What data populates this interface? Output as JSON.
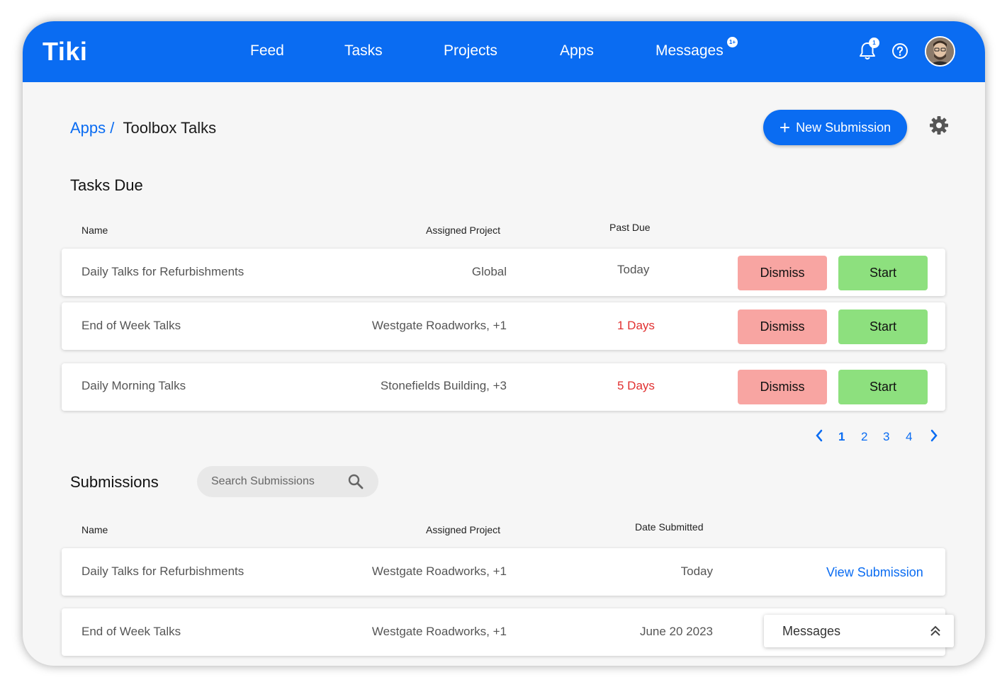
{
  "header": {
    "logo": "Tiki",
    "nav": [
      {
        "label": "Feed"
      },
      {
        "label": "Tasks"
      },
      {
        "label": "Projects"
      },
      {
        "label": "Apps"
      },
      {
        "label": "Messages",
        "badge": "1+"
      }
    ],
    "notification_badge": "1",
    "icons": [
      "bell-icon",
      "help-icon",
      "avatar"
    ]
  },
  "breadcrumb": {
    "parent": "Apps /",
    "current": "Toolbox Talks"
  },
  "actions": {
    "new_submission": "New Submission",
    "settings_icon": "gear-icon"
  },
  "tasks_due": {
    "title": "Tasks Due",
    "columns": {
      "name": "Name",
      "project": "Assigned Project",
      "past_due": "Past Due"
    },
    "rows": [
      {
        "name": "Daily Talks for Refurbishments",
        "project": "Global",
        "past_due": "Today",
        "overdue": false,
        "dismiss": "Dismiss",
        "start": "Start"
      },
      {
        "name": "End of Week Talks",
        "project": "Westgate Roadworks,  +1",
        "past_due": "1 Days",
        "overdue": true,
        "dismiss": "Dismiss",
        "start": "Start"
      },
      {
        "name": "Daily Morning Talks",
        "project": "Stonefields Building,  +3",
        "past_due": "5 Days",
        "overdue": true,
        "dismiss": "Dismiss",
        "start": "Start"
      }
    ],
    "pagination": {
      "pages": [
        "1",
        "2",
        "3",
        "4"
      ],
      "current": "1"
    }
  },
  "submissions": {
    "title": "Submissions",
    "search_placeholder": "Search Submissions",
    "columns": {
      "name": "Name",
      "project": "Assigned Project",
      "date": "Date Submitted"
    },
    "rows": [
      {
        "name": "Daily Talks for Refurbishments",
        "project": "Westgate Roadworks,  +1",
        "date": "Today",
        "action": "View Submission"
      },
      {
        "name": "End of Week Talks",
        "project": "Westgate Roadworks,  +1",
        "date": "June 20 2023"
      }
    ]
  },
  "messages_panel": {
    "label": "Messages"
  },
  "colors": {
    "brand": "#0a6cf2",
    "dismiss": "#f8a5a2",
    "start": "#8de07e",
    "overdue": "#e13030"
  }
}
